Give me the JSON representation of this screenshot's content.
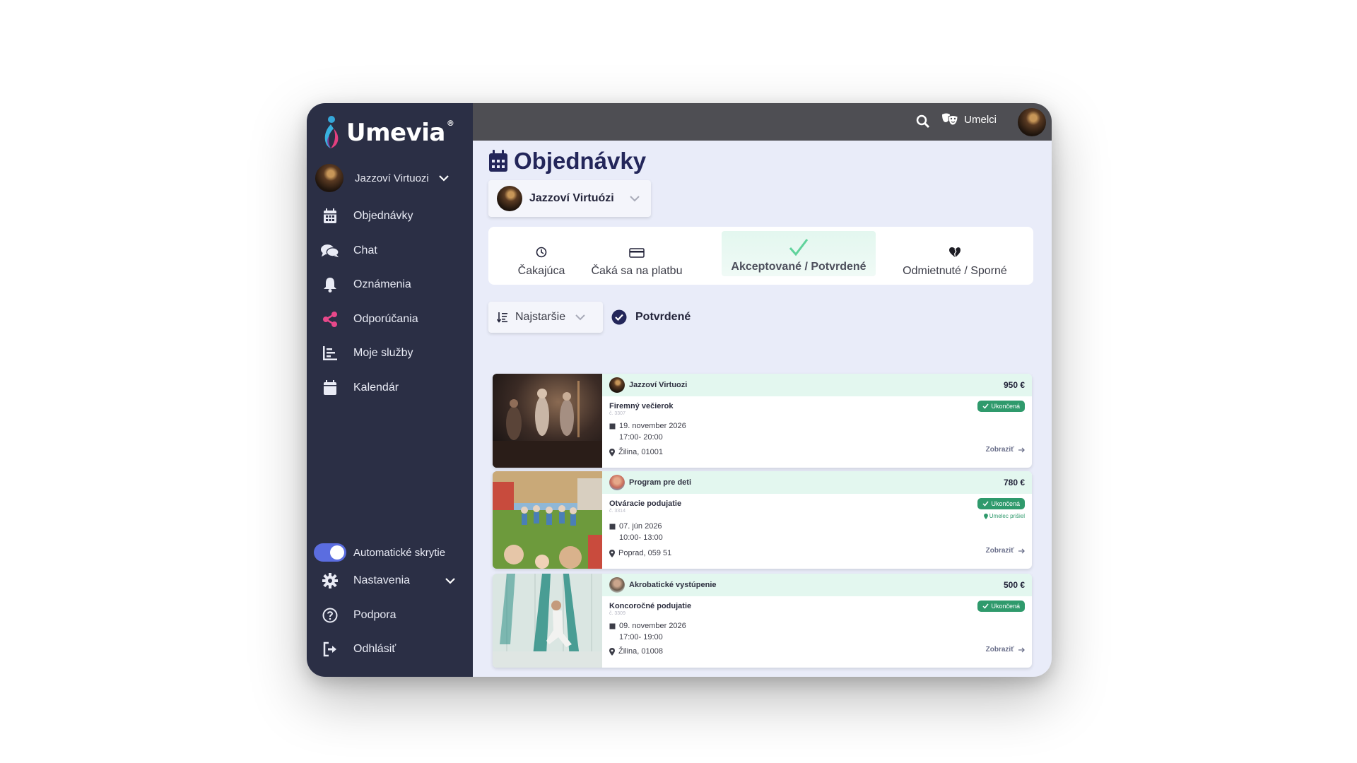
{
  "brand": {
    "name": "Umevia",
    "reg": "®"
  },
  "sidebar": {
    "profile_name": "Jazzoví Virtuozi",
    "items": [
      {
        "label": "Objednávky",
        "icon": "calendar-icon"
      },
      {
        "label": "Chat",
        "icon": "chat-icon"
      },
      {
        "label": "Oznámenia",
        "icon": "bell-icon"
      },
      {
        "label": "Odporúčania",
        "icon": "share-icon"
      },
      {
        "label": "Moje služby",
        "icon": "services-icon"
      },
      {
        "label": "Kalendár",
        "icon": "calendar-icon"
      }
    ],
    "auto_hide_label": "Automatické skrytie",
    "auto_hide_on": true,
    "bottom_items": [
      {
        "label": "Nastavenia",
        "icon": "gear-icon"
      },
      {
        "label": "Podpora",
        "icon": "help-icon"
      },
      {
        "label": "Odhlásiť",
        "icon": "logout-icon"
      }
    ]
  },
  "topbar": {
    "artists_label": "Umelci"
  },
  "main": {
    "title": "Objednávky",
    "artist_select": "Jazzoví Virtuózi",
    "tabs": [
      {
        "label": "Čakajúca",
        "icon": "clock-icon"
      },
      {
        "label": "Čaká sa na platbu",
        "icon": "card-icon"
      },
      {
        "label": "Akceptované / Potvrdené",
        "icon": "check-icon",
        "active": true
      },
      {
        "label": "Odmietnuté / Sporné",
        "icon": "broken-heart-icon"
      }
    ],
    "sort_label": "Najstaršie",
    "filter_label": "Potvrdené"
  },
  "orders": [
    {
      "artist": "Jazzoví Virtuozi",
      "price": "950 €",
      "event": "Firemný večierok",
      "number": "č. 3307",
      "date": "19. november 2026",
      "time": "17:00- 20:00",
      "location": "Žilina, 01001",
      "status": "Ukončená",
      "note": "",
      "detail": "Zobraziť"
    },
    {
      "artist": "Program pre deti",
      "price": "780 €",
      "event": "Otváracie podujatie",
      "number": "č. 3314",
      "date": "07. jún 2026",
      "time": "10:00- 13:00",
      "location": "Poprad, 059 51",
      "status": "Ukončená",
      "note": "Umelec prišiel",
      "detail": "Zobraziť"
    },
    {
      "artist": "Akrobatické vystúpenie",
      "price": "500 €",
      "event": "Koncoročné podujatie",
      "number": "č. 3309",
      "date": "09. november 2026",
      "time": "17:00- 19:00",
      "location": "Žilina, 01008",
      "status": "Ukončená",
      "note": "",
      "detail": "Zobraziť"
    }
  ],
  "colors": {
    "sidebar": "#2b2f45",
    "topbar": "#4e4e53",
    "background": "#e9ecf9",
    "accent_green": "#2f9a6c",
    "title": "#23265a",
    "toggle": "#5b6de0"
  }
}
